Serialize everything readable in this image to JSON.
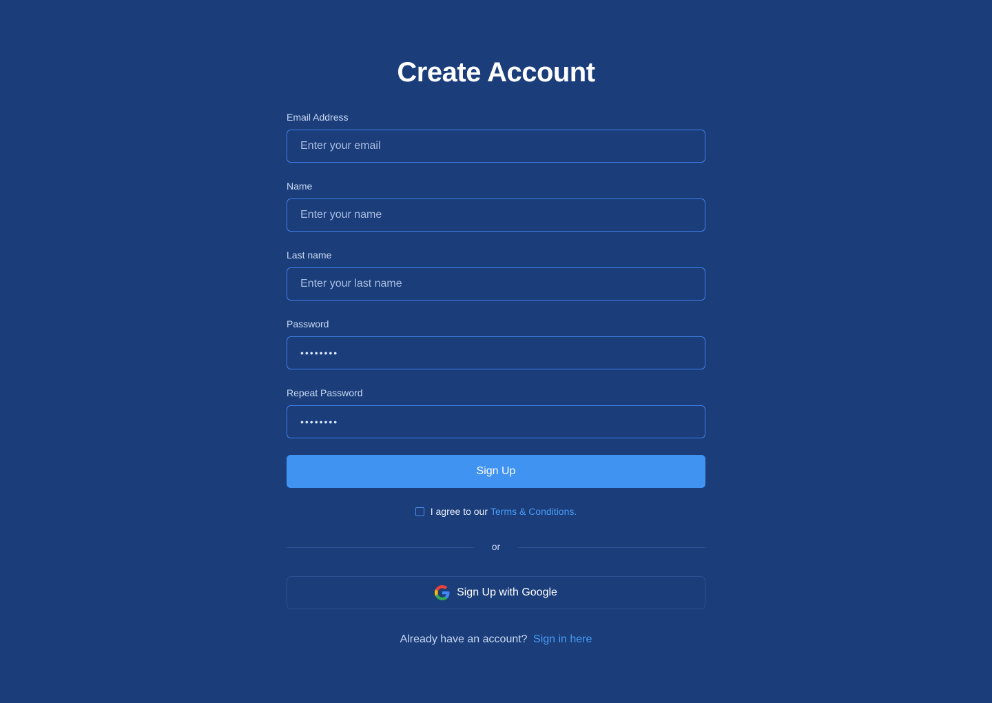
{
  "title": "Create Account",
  "fields": {
    "email": {
      "label": "Email Address",
      "placeholder": "Enter your email"
    },
    "name": {
      "label": "Name",
      "placeholder": "Enter your name"
    },
    "last_name": {
      "label": "Last name",
      "placeholder": "Enter your last name"
    },
    "password": {
      "label": "Password",
      "value": "••••••••"
    },
    "repeat_password": {
      "label": "Repeat Password",
      "value": "••••••••"
    }
  },
  "signup_button": "Sign Up",
  "terms": {
    "checked": false,
    "text": "I agree to our",
    "link": "Terms & Conditions."
  },
  "divider_text": "or",
  "google_button": {
    "label": "Sign Up with Google",
    "icon": "google-icon"
  },
  "signin": {
    "text": "Already have an account?",
    "link": "Sign in here"
  },
  "colors": {
    "background": "#1b3e7b",
    "accent": "#4193f2",
    "link": "#4a9bf5",
    "input_border": "#3f7fe6"
  }
}
